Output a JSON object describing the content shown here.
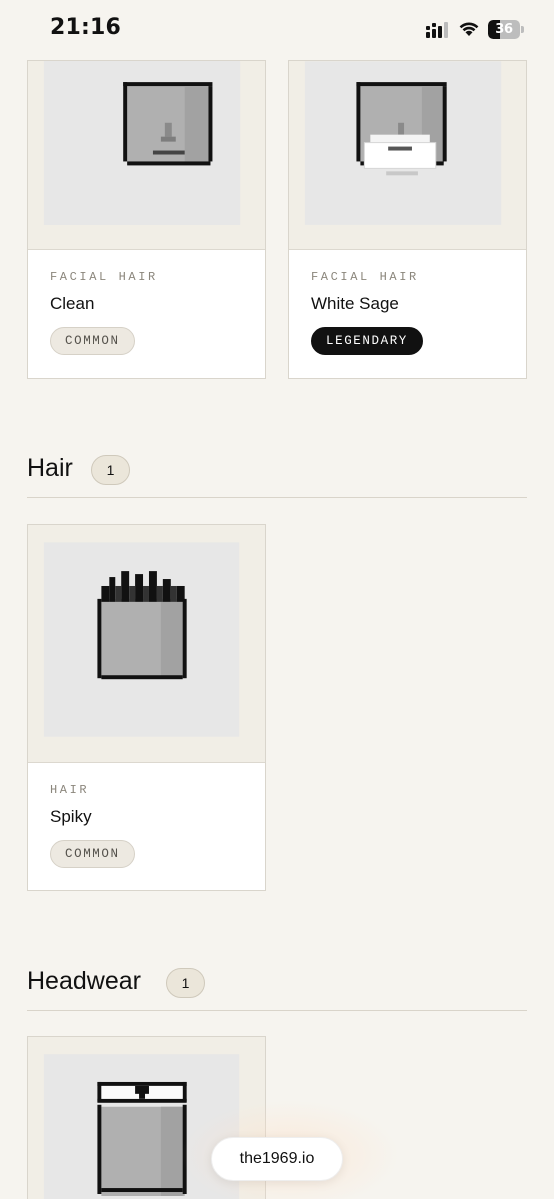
{
  "status_bar": {
    "time": "21:16",
    "battery_percent": "36",
    "icons": [
      "cellular-signal-icon",
      "wifi-icon",
      "battery-icon"
    ]
  },
  "cards": [
    {
      "category": "FACIAL HAIR",
      "name": "Clean",
      "rarity": "COMMON",
      "art": "clean-face-pixel-art"
    },
    {
      "category": "FACIAL HAIR",
      "name": "White Sage",
      "rarity": "LEGENDARY",
      "art": "white-sage-beard-pixel-art"
    },
    {
      "category": "HAIR",
      "name": "Spiky",
      "rarity": "COMMON",
      "art": "spiky-hair-pixel-art"
    },
    {
      "category": "",
      "name": "",
      "rarity": "",
      "art": "headwear-pixel-art"
    }
  ],
  "sections": [
    {
      "title": "Hair",
      "count": "1"
    },
    {
      "title": "Headwear",
      "count": "1"
    }
  ],
  "footer_pill": {
    "label": "the1969.io"
  },
  "colors": {
    "background": "#f6f4ef",
    "legendary_badge": "#111111",
    "common_badge": "#ede9e1"
  }
}
